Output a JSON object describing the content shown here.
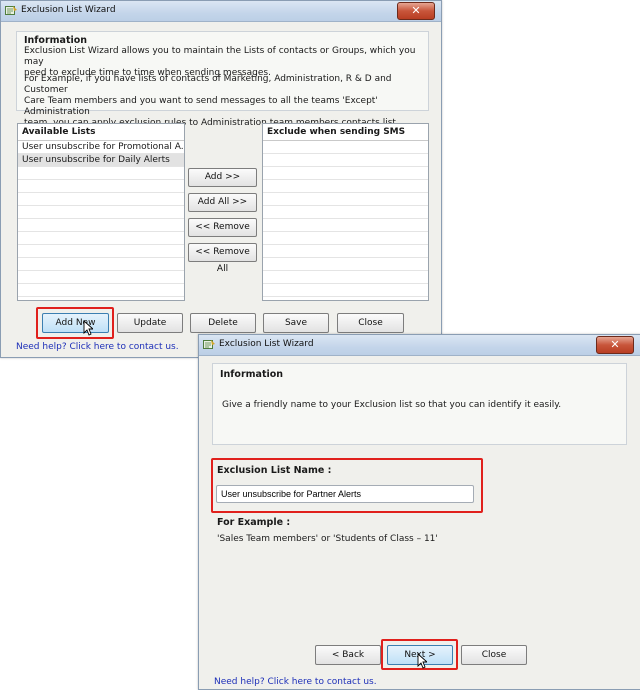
{
  "window1": {
    "title": "Exclusion List Wizard",
    "close_glyph": "✕",
    "info_title": "Information",
    "info_lines_1": [
      "Exclusion List Wizard allows you to maintain the Lists of contacts or Groups, which you may",
      "need to exclude time to time when sending messages."
    ],
    "info_lines_2": [
      "For Example, if you have lists of contacts of Marketing, Administration, R & D and Customer",
      "Care Team members and you want to send messages to all the teams 'Except' Administration",
      "team, you can apply exclusion rules to Administration team members contacts list."
    ],
    "available_header": "Available Lists",
    "available_items": [
      "User unsubscribe for Promotional A...",
      "User unsubscribe for Daily Alerts"
    ],
    "exclude_header": "Exclude when sending SMS",
    "move_buttons": [
      "Add >>",
      "Add All >>",
      "<< Remove",
      "<< Remove All"
    ],
    "bottom_buttons": [
      "Add New",
      "Update",
      "Delete",
      "Save",
      "Close"
    ],
    "help_link": "Need help? Click here to contact us."
  },
  "window2": {
    "title": "Exclusion List Wizard",
    "close_glyph": "✕",
    "info_title": "Information",
    "info_text": "Give a friendly name to your Exclusion list so that you can identify it easily.",
    "name_label": "Exclusion List Name :",
    "name_value": "User unsubscribe for Partner Alerts",
    "example_label": "For Example :",
    "example_text": "'Sales Team members' or 'Students of Class – 11'",
    "back_button": "< Back",
    "next_button": "Next >",
    "close_button": "Close",
    "help_link": "Need help? Click here to contact us."
  },
  "icons": {
    "title_icon": "wizard-icon",
    "cursor": "mouse-pointer-icon"
  },
  "colors": {
    "highlight_box": "#e0201c",
    "link": "#1d2fb8",
    "selected_button": "#bfe0f7"
  }
}
